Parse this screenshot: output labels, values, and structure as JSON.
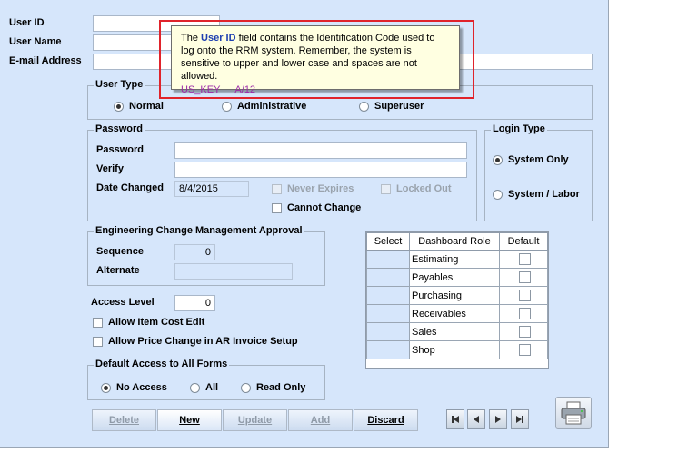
{
  "user": {
    "id_label": "User ID",
    "name_label": "User Name",
    "email_label": "E-mail Address"
  },
  "tooltip": {
    "pre": "The ",
    "field": "User ID",
    "post": " field contains the Identification Code used to log onto the RRM system.  Remember, the system is sensitive to upper and lower case and spaces are not allowed.",
    "code_key": "US_KEY",
    "code_type": "A/12"
  },
  "user_type": {
    "legend": "User Type",
    "options": [
      "Normal",
      "Administrative",
      "Superuser"
    ],
    "selected": "Normal"
  },
  "password": {
    "legend": "Password",
    "password_label": "Password",
    "verify_label": "Verify",
    "date_changed_label": "Date Changed",
    "date_changed_value": "8/4/2015",
    "never_expires_label": "Never Expires",
    "locked_out_label": "Locked Out",
    "cannot_change_label": "Cannot Change"
  },
  "login_type": {
    "legend": "Login Type",
    "options": [
      "System Only",
      "System / Labor"
    ],
    "selected": "System Only"
  },
  "ecm": {
    "legend": "Engineering Change Management Approval",
    "sequence_label": "Sequence",
    "sequence_value": "0",
    "alternate_label": "Alternate"
  },
  "dashboard": {
    "columns": [
      "Select",
      "Dashboard Role",
      "Default"
    ],
    "roles": [
      "Estimating",
      "Payables",
      "Purchasing",
      "Receivables",
      "Sales",
      "Shop"
    ]
  },
  "access": {
    "level_label": "Access Level",
    "level_value": "0",
    "item_cost_label": "Allow Item Cost Edit",
    "price_change_label": "Allow Price Change in AR Invoice Setup"
  },
  "default_access": {
    "legend": "Default Access to All Forms",
    "options": [
      "No Access",
      "All",
      "Read Only"
    ],
    "selected": "No Access"
  },
  "buttons": {
    "delete": "Delete",
    "new": "New",
    "update": "Update",
    "add": "Add",
    "discard": "Discard"
  },
  "icons": {
    "nav_first": "first-record-icon",
    "nav_prev": "previous-record-icon",
    "nav_next": "next-record-icon",
    "nav_last": "last-record-icon",
    "print": "printer-icon"
  }
}
